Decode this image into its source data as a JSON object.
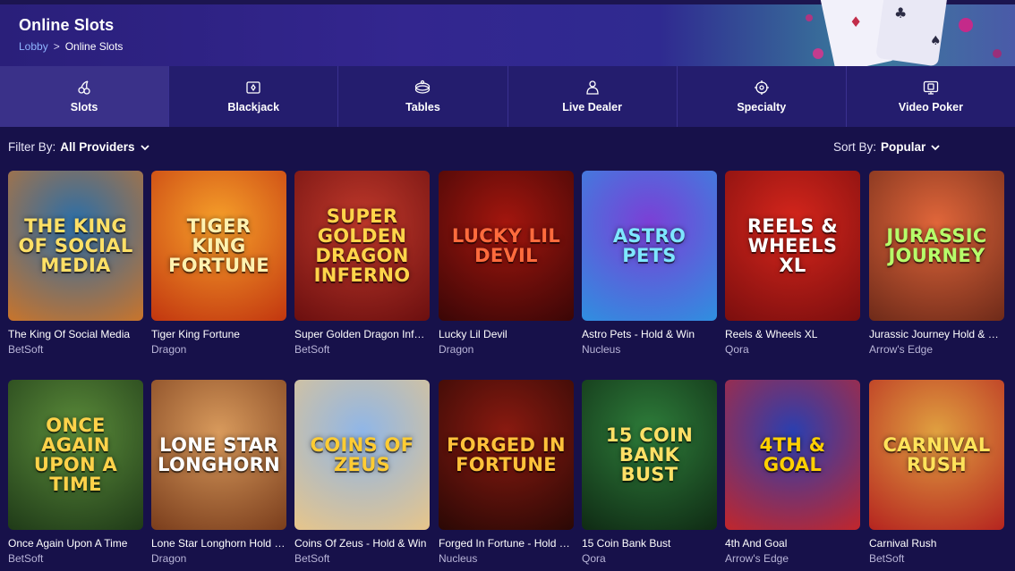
{
  "header": {
    "title": "Online Slots",
    "breadcrumb": {
      "home": "Lobby",
      "separator": ">",
      "current": "Online Slots"
    }
  },
  "tabs": [
    {
      "label": "Slots",
      "icon": "cherries-icon",
      "active": true
    },
    {
      "label": "Blackjack",
      "icon": "cards-icon",
      "active": false
    },
    {
      "label": "Tables",
      "icon": "roulette-icon",
      "active": false
    },
    {
      "label": "Live Dealer",
      "icon": "dealer-icon",
      "active": false
    },
    {
      "label": "Specialty",
      "icon": "specialty-icon",
      "active": false
    },
    {
      "label": "Video Poker",
      "icon": "video-poker-icon",
      "active": false
    }
  ],
  "filter": {
    "label": "Filter By:",
    "value": "All Providers"
  },
  "sort": {
    "label": "Sort By:",
    "value": "Popular"
  },
  "games": [
    {
      "title": "The King Of Social Media",
      "provider": "BetSoft",
      "art": "The King of Social Media",
      "bg": [
        "#2b6ea8",
        "#c9742b"
      ],
      "fg": "#ffe066"
    },
    {
      "title": "Tiger King Fortune",
      "provider": "Dragon",
      "art": "Tiger King Fortune",
      "bg": [
        "#f6a02a",
        "#c2360f"
      ],
      "fg": "#fff2b0"
    },
    {
      "title": "Super Golden Dragon Inferno",
      "provider": "BetSoft",
      "art": "Super Golden Dragon Inferno",
      "bg": [
        "#c0392b",
        "#6b0f0f"
      ],
      "fg": "#ffd54a"
    },
    {
      "title": "Lucky Lil Devil",
      "provider": "Dragon",
      "art": "Lucky Lil Devil",
      "bg": [
        "#a3160e",
        "#3a0606"
      ],
      "fg": "#ff6b3d"
    },
    {
      "title": "Astro Pets - Hold & Win",
      "provider": "Nucleus",
      "art": "Astro Pets",
      "bg": [
        "#7b3fd6",
        "#2f8fe0"
      ],
      "fg": "#7ee7ff"
    },
    {
      "title": "Reels & Wheels XL",
      "provider": "Qora",
      "art": "Reels & Wheels XL",
      "bg": [
        "#d6261c",
        "#7b0e0e"
      ],
      "fg": "#ffffff"
    },
    {
      "title": "Jurassic Journey Hold & Win",
      "provider": "Arrow's Edge",
      "art": "Jurassic Journey",
      "bg": [
        "#e0663a",
        "#6e2a19"
      ],
      "fg": "#b6ff6a"
    },
    {
      "title": "Once Again Upon A Time",
      "provider": "BetSoft",
      "art": "Once Again Upon a Time",
      "bg": [
        "#5b8c3a",
        "#1f3a18"
      ],
      "fg": "#ffd24a"
    },
    {
      "title": "Lone Star Longhorn Hold & Win",
      "provider": "Dragon",
      "art": "Lone Star Longhorn",
      "bg": [
        "#d89a5c",
        "#7a3d1c"
      ],
      "fg": "#ffffff"
    },
    {
      "title": "Coins Of Zeus - Hold & Win",
      "provider": "BetSoft",
      "art": "Coins of Zeus",
      "bg": [
        "#8fb6e8",
        "#e7c58a"
      ],
      "fg": "#ffcc33"
    },
    {
      "title": "Forged In Fortune - Hold & Win",
      "provider": "Nucleus",
      "art": "Forged in Fortune",
      "bg": [
        "#8a1a10",
        "#2a0805"
      ],
      "fg": "#ffc23a"
    },
    {
      "title": "15 Coin Bank Bust",
      "provider": "Qora",
      "art": "15 Coin Bank Bust",
      "bg": [
        "#2e7d3a",
        "#0f2a14"
      ],
      "fg": "#ffe066"
    },
    {
      "title": "4th And Goal",
      "provider": "Arrow's Edge",
      "art": "4th & Goal",
      "bg": [
        "#2a3fb0",
        "#c2262b"
      ],
      "fg": "#ffd000"
    },
    {
      "title": "Carnival Rush",
      "provider": "BetSoft",
      "art": "Carnival Rush",
      "bg": [
        "#e0a040",
        "#b5241f"
      ],
      "fg": "#ffe35a"
    }
  ],
  "colors": {
    "page_bg": "#17114a",
    "tab_bg": "#241d6e",
    "tab_active": "#3a3189",
    "link": "#8fb4ff",
    "muted": "#b9b5d8"
  }
}
